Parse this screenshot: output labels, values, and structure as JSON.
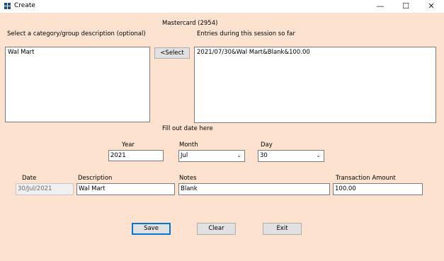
{
  "window": {
    "title": "Create",
    "minimize_glyph": "—",
    "maximize_glyph": "☐",
    "close_glyph": "✕"
  },
  "account_label": "Mastercard (2954)",
  "category_label": "Select a category/group description (optional)",
  "category_list": {
    "items": [
      "Wal Mart"
    ]
  },
  "select_button": "<Select",
  "entries_label": "Entries during this session so far",
  "entries_list": {
    "items": [
      "2021/07/30&Wal Mart&Blank&100.00"
    ]
  },
  "date_prompt": "Fill out date here",
  "year": {
    "label": "Year",
    "value": "2021"
  },
  "month": {
    "label": "Month",
    "value": "Jul"
  },
  "day": {
    "label": "Day",
    "value": "30"
  },
  "fields": {
    "date": {
      "label": "Date",
      "value": "30/Jul/2021"
    },
    "description": {
      "label": "Description",
      "value": "Wal Mart"
    },
    "notes": {
      "label": "Notes",
      "value": "Blank"
    },
    "amount": {
      "label": "Transaction Amount",
      "value": "100.00"
    }
  },
  "buttons": {
    "save": "Save",
    "clear": "Clear",
    "exit": "Exit"
  },
  "colors": {
    "background": "#fde3cf",
    "focus_border": "#0078d7"
  }
}
